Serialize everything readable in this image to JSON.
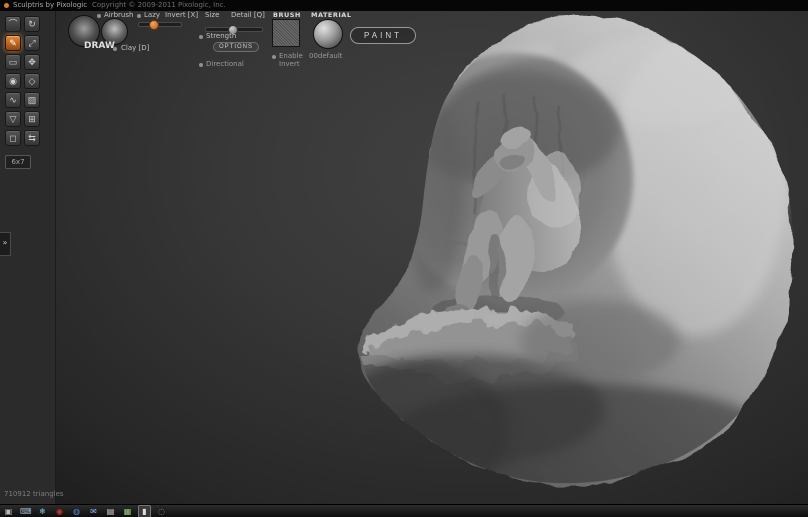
{
  "titlebar": {
    "title": "Sculptris by Pixologic",
    "copyright": "Copyright © 2009-2011 Pixologic, Inc."
  },
  "topbar": {
    "airbrush": "Airbrush",
    "lazy": "Lazy",
    "invert": "Invert [X]",
    "mode": "DRAW",
    "tool": "Clay [D]",
    "size": "Size",
    "detail": "Detail [Q]",
    "strength": "Strength",
    "options": "OPTIONS",
    "directional": "Directional",
    "brush_title": "BRUSH",
    "enable_line1": "Enable",
    "enable_line2": "Invert",
    "material_title": "MATERIAL",
    "material_name": "00default",
    "paint": "PAINT",
    "accent_orange": "#d4802f"
  },
  "sidebar": {
    "grid_label": "6x7",
    "tools": [
      {
        "name": "crease",
        "glyph": "⌒"
      },
      {
        "name": "rotate",
        "glyph": "↻"
      },
      {
        "name": "draw",
        "glyph": "✎",
        "active": true
      },
      {
        "name": "scale",
        "glyph": "⤢"
      },
      {
        "name": "flatten",
        "glyph": "▭"
      },
      {
        "name": "grab",
        "glyph": "✥"
      },
      {
        "name": "inflate",
        "glyph": "◉"
      },
      {
        "name": "pinch",
        "glyph": "◇"
      },
      {
        "name": "smooth",
        "glyph": "∿"
      },
      {
        "name": "mask",
        "glyph": "▨"
      },
      {
        "name": "reduce-brush",
        "glyph": "▽"
      },
      {
        "name": "subdivide",
        "glyph": "⊞"
      },
      {
        "name": "wireframe",
        "glyph": "◻"
      },
      {
        "name": "symmetry",
        "glyph": "⇆"
      }
    ]
  },
  "flyout": {
    "glyph": "»"
  },
  "status": {
    "triangles": "710912 triangles"
  },
  "taskbar": {
    "icons": [
      {
        "name": "files",
        "glyph": "▣",
        "css": "color:#b8b8b8"
      },
      {
        "name": "keyboard",
        "glyph": "⌨",
        "css": "color:#9fb6c9"
      },
      {
        "name": "snowflake",
        "glyph": "❄",
        "css": "color:#7ec8e3"
      },
      {
        "name": "media-player",
        "glyph": "◉",
        "css": "color:#c0392b"
      },
      {
        "name": "browser",
        "glyph": "◍",
        "css": "color:#4a90d9"
      },
      {
        "name": "mail",
        "glyph": "✉",
        "css": "color:#8ab4f8"
      },
      {
        "name": "text-editor",
        "glyph": "▤",
        "css": "color:#d9d9d9"
      },
      {
        "name": "image-viewer",
        "glyph": "▦",
        "css": "color:#9acd7e"
      },
      {
        "name": "terminal",
        "glyph": "▮",
        "css": "color:#e0e0e0",
        "active": true
      },
      {
        "name": "settings",
        "glyph": "◌",
        "css": "color:#a0a0a0"
      }
    ]
  }
}
